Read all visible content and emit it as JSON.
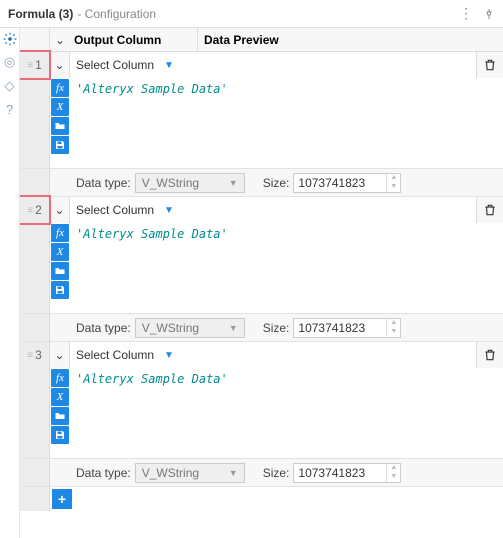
{
  "header": {
    "title": "Formula (3)",
    "subtitle": "- Configuration"
  },
  "columns": {
    "output": "Output Column",
    "preview": "Data Preview"
  },
  "labels": {
    "select_column": "Select Column",
    "data_type": "Data type:",
    "size": "Size:"
  },
  "icons": {
    "fx": "fx",
    "x": "X",
    "folder": "▣",
    "save": "▫"
  },
  "rows": [
    {
      "index": "1",
      "highlighted": true,
      "expression": "'Alteryx Sample Data'",
      "data_type": "V_WString",
      "size": "1073741823"
    },
    {
      "index": "2",
      "highlighted": true,
      "expression": "'Alteryx Sample Data'",
      "data_type": "V_WString",
      "size": "1073741823"
    },
    {
      "index": "3",
      "highlighted": false,
      "expression": "'Alteryx Sample Data'",
      "data_type": "V_WString",
      "size": "1073741823"
    }
  ]
}
